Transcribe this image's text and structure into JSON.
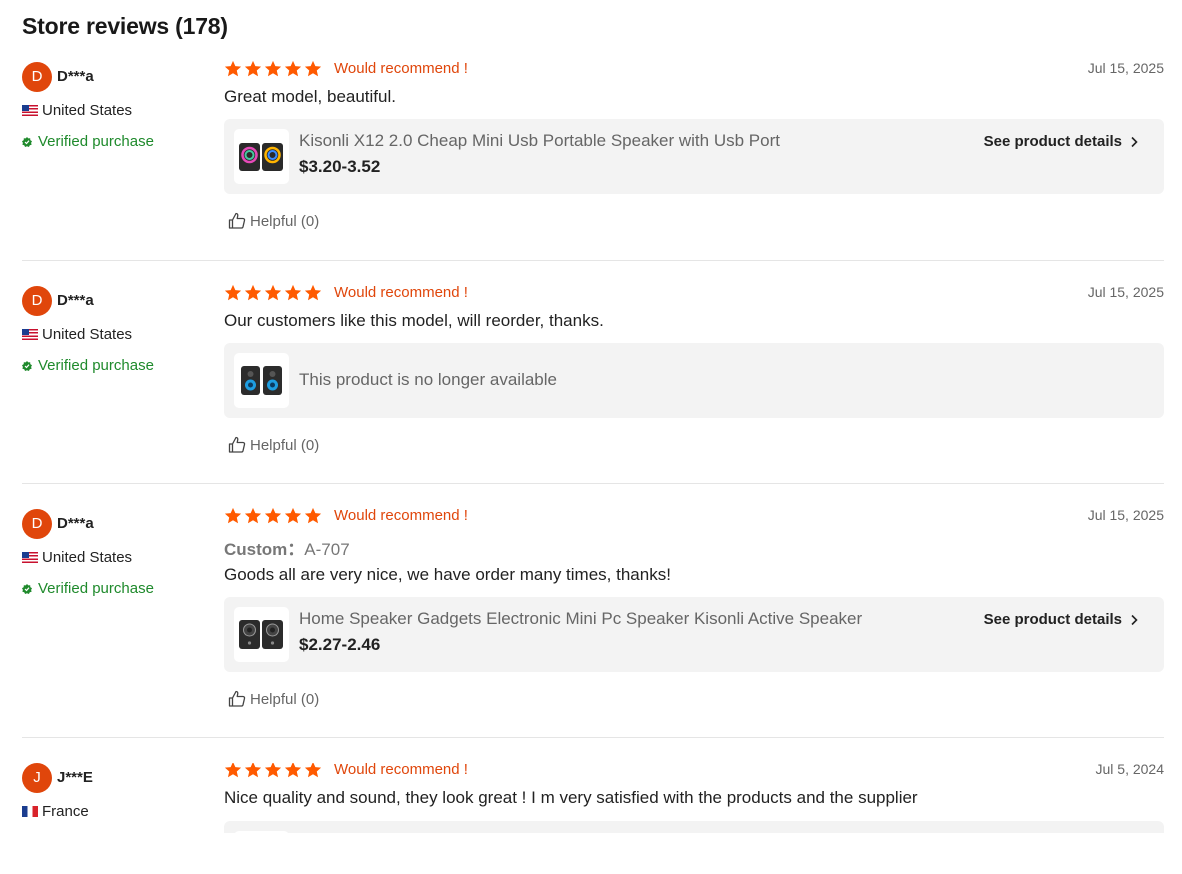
{
  "page": {
    "title": "Store reviews (178)"
  },
  "reviews": [
    {
      "avatar_letter": "D",
      "user": "D***a",
      "country": "United States",
      "flag": "us",
      "verified": "Verified purchase",
      "rating": 5,
      "recommend": "Would recommend !",
      "date": "Jul 15, 2025",
      "text": "Great model, beautiful.",
      "product": {
        "name": "Kisonli X12 2.0 Cheap Mini Usb Portable Speaker with Usb Port",
        "price": "$3.20-3.52",
        "details": "See product details"
      },
      "helpful": "Helpful (0)"
    },
    {
      "avatar_letter": "D",
      "user": "D***a",
      "country": "United States",
      "flag": "us",
      "verified": "Verified purchase",
      "rating": 5,
      "recommend": "Would recommend !",
      "date": "Jul 15, 2025",
      "text": "Our customers like this model, will reorder, thanks.",
      "product": {
        "name": "This product is no longer available"
      },
      "helpful": "Helpful (0)"
    },
    {
      "avatar_letter": "D",
      "user": "D***a",
      "country": "United States",
      "flag": "us",
      "verified": "Verified purchase",
      "rating": 5,
      "recommend": "Would recommend !",
      "date": "Jul 15, 2025",
      "custom_label": "Custom：",
      "custom_value": "A-707",
      "text": "Goods all are very nice, we have order many times, thanks!",
      "product": {
        "name": "Home Speaker Gadgets Electronic Mini Pc Speaker Kisonli Active Speaker",
        "price": "$2.27-2.46",
        "details": "See product details"
      },
      "helpful": "Helpful (0)"
    },
    {
      "avatar_letter": "J",
      "user": "J***E",
      "country": "France",
      "flag": "fr",
      "rating": 5,
      "recommend": "Would recommend !",
      "date": "Jul 5, 2024",
      "text": "Nice quality and sound, they look great ! I m very satisfied with the products and the supplier"
    }
  ],
  "colors": {
    "accent": "#e0460b",
    "star": "#ff5a00",
    "verified": "#1f8a2c"
  },
  "icons": [
    "star-icon",
    "verified-icon",
    "thumbs-up-icon",
    "chevron-right-icon"
  ]
}
